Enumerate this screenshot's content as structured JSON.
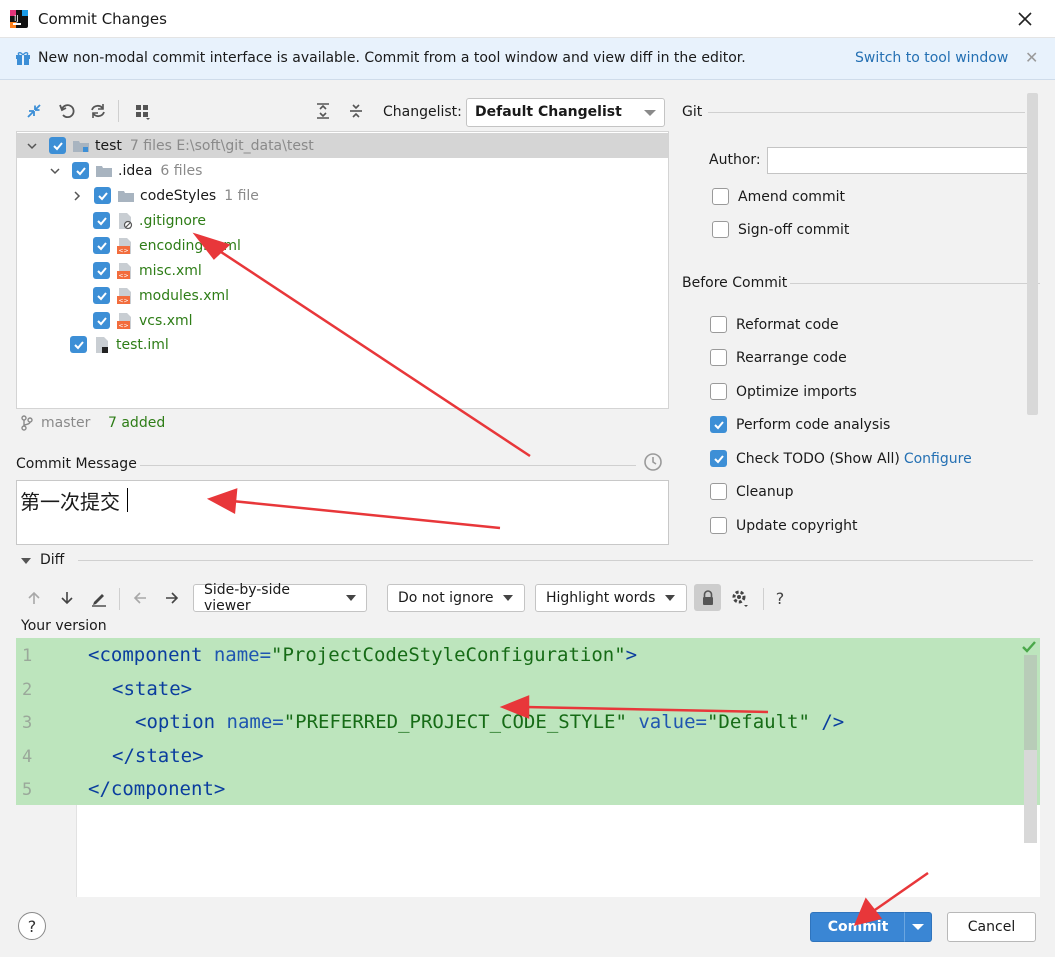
{
  "window": {
    "title": "Commit Changes"
  },
  "banner": {
    "text": "New non-modal commit interface is available. Commit from a tool window and view diff in the editor.",
    "link": "Switch to tool window"
  },
  "toolbar": {
    "changelist_label": "Changelist:",
    "changelist_value": "Default Changelist"
  },
  "tree": {
    "rows": [
      {
        "name": "test",
        "meta": "7 files  E:\\soft\\git_data\\test"
      },
      {
        "name": ".idea",
        "meta": "6 files"
      },
      {
        "name": "codeStyles",
        "meta": "1 file"
      },
      {
        "name": ".gitignore"
      },
      {
        "name": "encodings.xml"
      },
      {
        "name": "misc.xml"
      },
      {
        "name": "modules.xml"
      },
      {
        "name": "vcs.xml"
      },
      {
        "name": "test.iml"
      }
    ]
  },
  "status": {
    "branch": "master",
    "added": "7 added"
  },
  "commit_message": {
    "label": "Commit Message",
    "value": "第一次提交"
  },
  "git": {
    "section": "Git",
    "author_label": "Author:",
    "author_value": "",
    "amend": "Amend commit",
    "signoff": "Sign-off commit"
  },
  "before_commit": {
    "section": "Before Commit",
    "options": [
      {
        "label": "Reformat code",
        "checked": false
      },
      {
        "label": "Rearrange code",
        "checked": false
      },
      {
        "label": "Optimize imports",
        "checked": false
      },
      {
        "label": "Perform code analysis",
        "checked": true
      },
      {
        "label": "Check TODO (Show All)",
        "checked": true,
        "link": "Configure"
      },
      {
        "label": "Cleanup",
        "checked": false
      },
      {
        "label": "Update copyright",
        "checked": false
      }
    ]
  },
  "diff": {
    "label": "Diff",
    "viewer": "Side-by-side viewer",
    "ignore": "Do not ignore",
    "highlight": "Highlight words",
    "help": "?",
    "your_version": "Your version",
    "line_numbers": [
      "1",
      "2",
      "3",
      "4",
      "5"
    ],
    "code": {
      "l1": {
        "open": "<component ",
        "attr": "name=",
        "val": "\"ProjectCodeStyleConfiguration\"",
        "close": ">"
      },
      "l2": "<state>",
      "l3": {
        "open": "<option ",
        "attr1": "name=",
        "val1": "\"PREFERRED_PROJECT_CODE_STYLE\"",
        "attr2": " value=",
        "val2": "\"Default\"",
        "close": " />"
      },
      "l4": "</state>",
      "l5": "</component>"
    }
  },
  "buttons": {
    "help": "?",
    "commit": "Commit",
    "cancel": "Cancel"
  },
  "colors": {
    "accent": "#3a86d4",
    "added": "#2e7d17",
    "diff_bg": "#bde5bd",
    "annotation": "#e8373a"
  }
}
